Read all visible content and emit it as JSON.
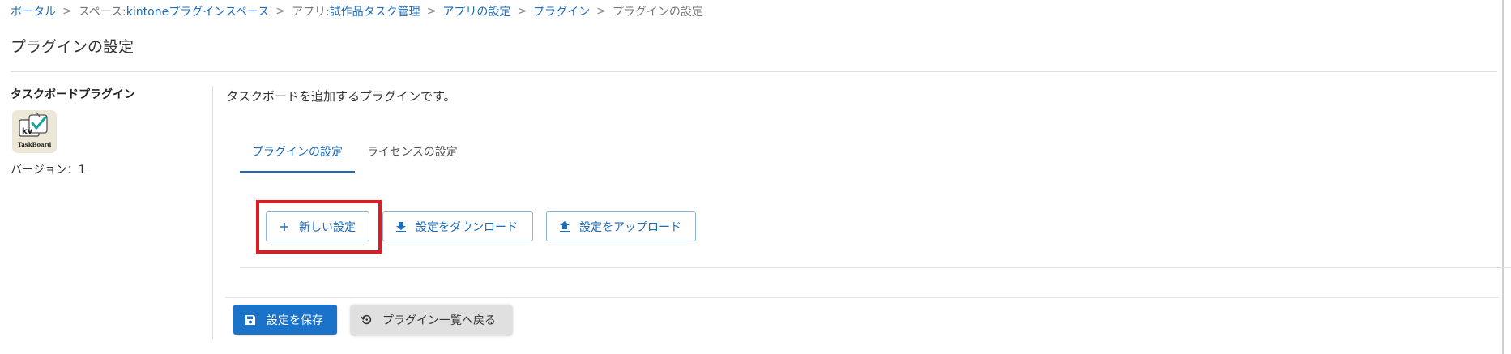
{
  "breadcrumb": {
    "portal": "ポータル",
    "space_prefix": "スペース: ",
    "space": "kintoneプラグインスペース",
    "app_prefix": "アプリ: ",
    "app": "試作品タスク管理",
    "app_settings": "アプリの設定",
    "plugins": "プラグイン",
    "current": "プラグインの設定",
    "separator": ">"
  },
  "page": {
    "title": "プラグインの設定"
  },
  "plugin": {
    "name": "タスクボードプラグイン",
    "icon_name": "taskboard-plugin-icon",
    "icon_text_kv": "kv",
    "icon_text_label": "TaskBoard",
    "version": "バージョン：1",
    "description": "タスクボードを追加するプラグインです。"
  },
  "tabs": [
    {
      "label": "プラグインの設定",
      "active": true
    },
    {
      "label": "ライセンスの設定",
      "active": false
    }
  ],
  "actions": {
    "new_setting": "新しい設定",
    "download_setting": "設定をダウンロード",
    "upload_setting": "設定をアップロード"
  },
  "footer": {
    "save": "設定を保存",
    "back": "プラグイン一覧へ戻る"
  },
  "colors": {
    "link": "#1e6bb8",
    "primary": "#1a73c8",
    "highlight": "#e01b24"
  }
}
